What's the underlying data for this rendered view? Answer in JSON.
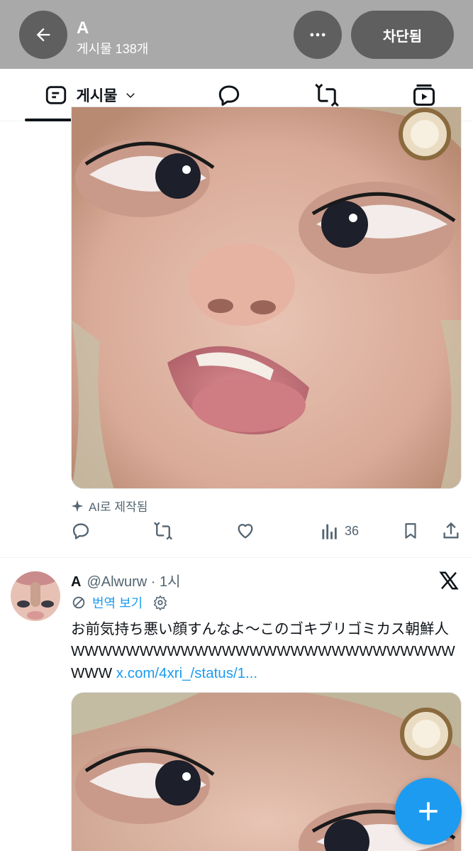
{
  "header": {
    "title": "A",
    "post_count": "게시물 138개",
    "blocked_label": "차단됨",
    "back_icon": "arrow-left-icon",
    "more_icon": "more-horizontal-icon",
    "background": "#a9a9a9"
  },
  "tabs": {
    "posts_label": "게시물",
    "posts_icon": "post-icon",
    "replies_icon": "reply-icon",
    "reposts_icon": "repost-icon",
    "media_icon": "media-icon"
  },
  "post1": {
    "ai_label": "AI로 제작됨",
    "views": "36",
    "action_icons": [
      "reply-icon",
      "repost-icon",
      "like-icon",
      "views-icon",
      "bookmark-icon",
      "share-icon"
    ]
  },
  "post2": {
    "name": "A",
    "handle_time": "@Alwurw · 1시",
    "translate_label": "번역 보기",
    "text": "お前気持ち悪い顔すんなよ～このゴキブリゴミカス朝鮮人WWWWWWWWWWWWWWWWWWWWWWWWWWWWWWW ",
    "link": "x.com/4xri_/status/1..."
  },
  "fab": {
    "icon": "plus-icon"
  },
  "colors": {
    "accent": "#1d9bf0",
    "text": "#0f1419",
    "secondary": "#536471"
  }
}
